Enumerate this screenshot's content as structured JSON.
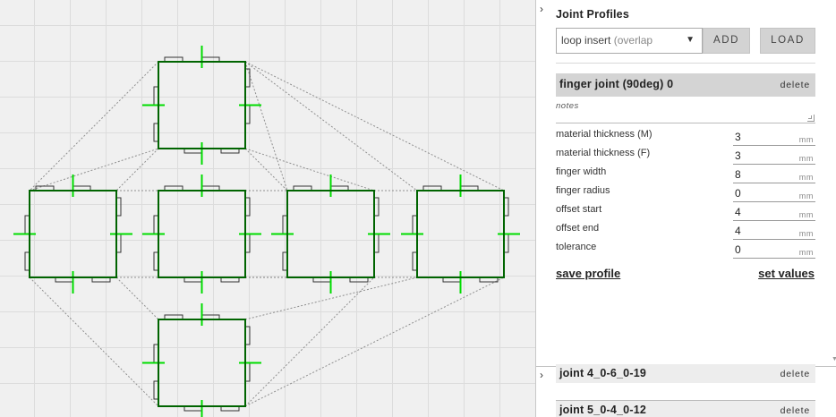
{
  "panel": {
    "collapse_glyph": "›",
    "title": "Joint Profiles",
    "select": {
      "value_main": "loop insert",
      "value_dim": "(overlap",
      "caret": "▼"
    },
    "add_label": "ADD",
    "load_label": "LOAD"
  },
  "active_profile": {
    "name": "finger joint (90deg) 0",
    "delete_label": "delete",
    "notes_label": "notes",
    "notes_value": "",
    "params": [
      {
        "label": "material thickness (M)",
        "value": "3",
        "unit": "mm"
      },
      {
        "label": "material thickness (F)",
        "value": "3",
        "unit": "mm"
      },
      {
        "label": "finger width",
        "value": "8",
        "unit": "mm"
      },
      {
        "label": "finger radius",
        "value": "0",
        "unit": "mm"
      },
      {
        "label": "offset start",
        "value": "4",
        "unit": "mm"
      },
      {
        "label": "offset end",
        "value": "4",
        "unit": "mm"
      },
      {
        "label": "tolerance",
        "value": "0",
        "unit": "mm"
      }
    ],
    "save_label": "save profile",
    "set_label": "set values"
  },
  "other_profiles": [
    {
      "name": "joint 4_0-6_0-19",
      "delete_label": "delete",
      "chevron": "›"
    },
    {
      "name": "joint 5_0-4_0-12",
      "delete_label": "delete"
    }
  ],
  "colors": {
    "box_stroke": "#006400",
    "marker_green": "#00dd00",
    "guide_gray": "#777777",
    "panel_header": "#d4d4d4"
  },
  "icons": [
    "chevron-right-icon",
    "caret-down-icon",
    "resize-grip-icon",
    "scroll-down-icon"
  ]
}
